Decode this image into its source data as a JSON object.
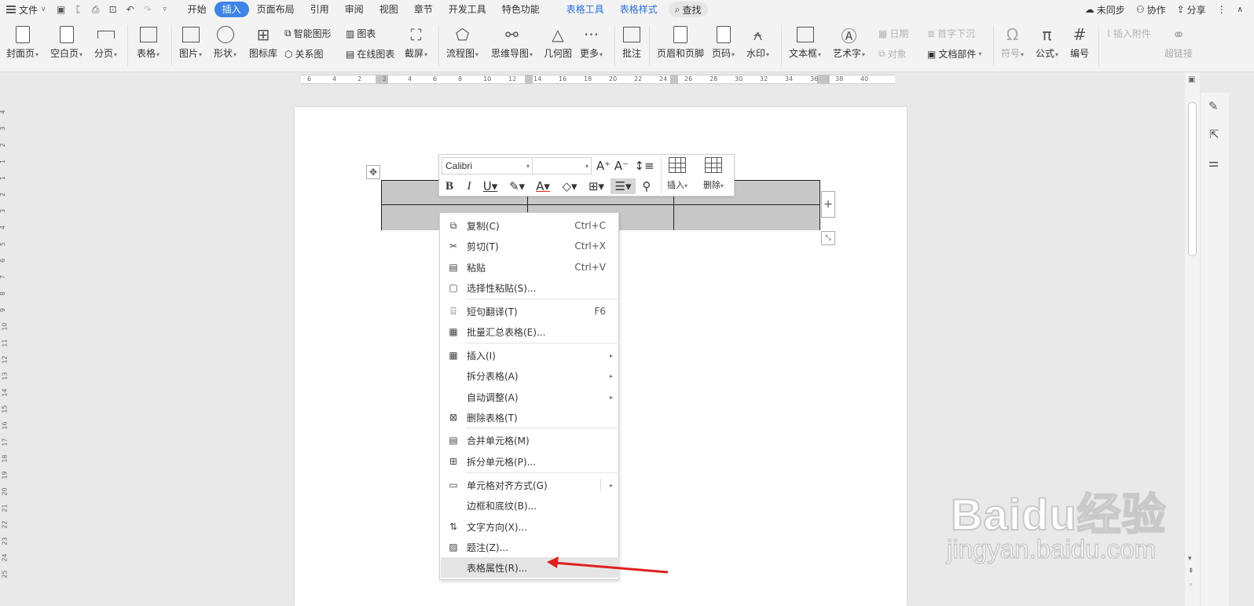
{
  "menubar": {
    "file_label": "文件",
    "tabs": [
      {
        "label": "开始"
      },
      {
        "label": "插入",
        "active": true
      },
      {
        "label": "页面布局"
      },
      {
        "label": "引用"
      },
      {
        "label": "审阅"
      },
      {
        "label": "视图"
      },
      {
        "label": "章节"
      },
      {
        "label": "开发工具"
      },
      {
        "label": "特色功能"
      },
      {
        "label": "表格工具",
        "contextual": true
      },
      {
        "label": "表格样式",
        "contextual": true
      }
    ],
    "search_label": "查找",
    "sync_label": "未同步",
    "collab_label": "协作",
    "share_label": "分享"
  },
  "ribbon": {
    "cover_page": "封面页",
    "blank_page": "空白页",
    "page_break": "分页",
    "table": "表格",
    "picture": "图片",
    "shape": "形状",
    "icon_library": "图标库",
    "smart_graphic": "智能图形",
    "chart": "图表",
    "relation_map": "关系图",
    "online_chart": "在线图表",
    "screenshot": "截屏",
    "flowchart": "流程图",
    "mindmap": "思维导图",
    "geometry": "几何图",
    "more": "更多",
    "comment": "批注",
    "header_footer": "页眉和页脚",
    "page_number": "页码",
    "watermark": "水印",
    "textbox": "文本框",
    "wordart": "艺术字",
    "date": "日期",
    "drop_cap": "首字下沉",
    "object": "对象",
    "doc_parts": "文档部件",
    "symbol": "符号",
    "formula": "公式",
    "numbering": "编号",
    "attachment": "插入附件",
    "hyperlink": "超链接"
  },
  "ruler": {
    "h_ticks": [
      "6",
      "4",
      "2",
      "2",
      "4",
      "6",
      "8",
      "10",
      "12",
      "14",
      "16",
      "18",
      "20",
      "22",
      "24",
      "26",
      "28",
      "30",
      "32",
      "34",
      "36",
      "38",
      "40"
    ],
    "v_ticks": [
      "4",
      "3",
      "2",
      "1",
      "1",
      "2",
      "3",
      "4",
      "5",
      "6",
      "7",
      "8",
      "9",
      "10",
      "11",
      "12",
      "13",
      "14",
      "15",
      "16",
      "17",
      "18",
      "19",
      "20",
      "21",
      "22",
      "23",
      "24",
      "25"
    ]
  },
  "mini_toolbar": {
    "font_name": "Calibri",
    "font_size": "",
    "insert_label": "插入",
    "delete_label": "删除"
  },
  "context_menu": {
    "items": [
      {
        "label": "复制(C)",
        "shortcut": "Ctrl+C",
        "icon": "copy-icon"
      },
      {
        "label": "剪切(T)",
        "shortcut": "Ctrl+X",
        "icon": "scissors-icon"
      },
      {
        "label": "粘贴",
        "shortcut": "Ctrl+V",
        "icon": "paste-icon"
      },
      {
        "label": "选择性粘贴(S)...",
        "shortcut": "",
        "icon": "paste-special-icon"
      },
      {
        "label": "短句翻译(T)",
        "shortcut": "F6",
        "icon": "translate-icon"
      },
      {
        "label": "批量汇总表格(E)...",
        "shortcut": "",
        "icon": "batch-table-icon"
      },
      {
        "label": "插入(I)",
        "shortcut": "",
        "icon": "table-insert-icon",
        "submenu": true
      },
      {
        "label": "拆分表格(A)",
        "shortcut": "",
        "icon": "",
        "submenu": true
      },
      {
        "label": "自动调整(A)",
        "shortcut": "",
        "icon": "",
        "submenu": true
      },
      {
        "label": "删除表格(T)",
        "shortcut": "",
        "icon": "table-delete-icon"
      },
      {
        "label": "合并单元格(M)",
        "shortcut": "",
        "icon": "merge-cells-icon"
      },
      {
        "label": "拆分单元格(P)...",
        "shortcut": "",
        "icon": "split-cells-icon"
      },
      {
        "label": "单元格对齐方式(G)",
        "shortcut": "",
        "icon": "cell-align-icon",
        "submenu": true
      },
      {
        "label": "边框和底纹(B)...",
        "shortcut": "",
        "icon": ""
      },
      {
        "label": "文字方向(X)...",
        "shortcut": "",
        "icon": "text-direction-icon"
      },
      {
        "label": "题注(Z)...",
        "shortcut": "",
        "icon": "caption-icon"
      },
      {
        "label": "表格属性(R)...",
        "shortcut": "",
        "icon": "",
        "highlighted": true
      }
    ]
  },
  "watermark_overlay": {
    "brand": "Baidu经验",
    "site": "jingyan.baidu.com"
  },
  "colors": {
    "accent": "#3e84e6",
    "contextual_tab": "#2b6fd6",
    "arrow": "#e02020",
    "selected_cell": "#c8c8c8"
  }
}
